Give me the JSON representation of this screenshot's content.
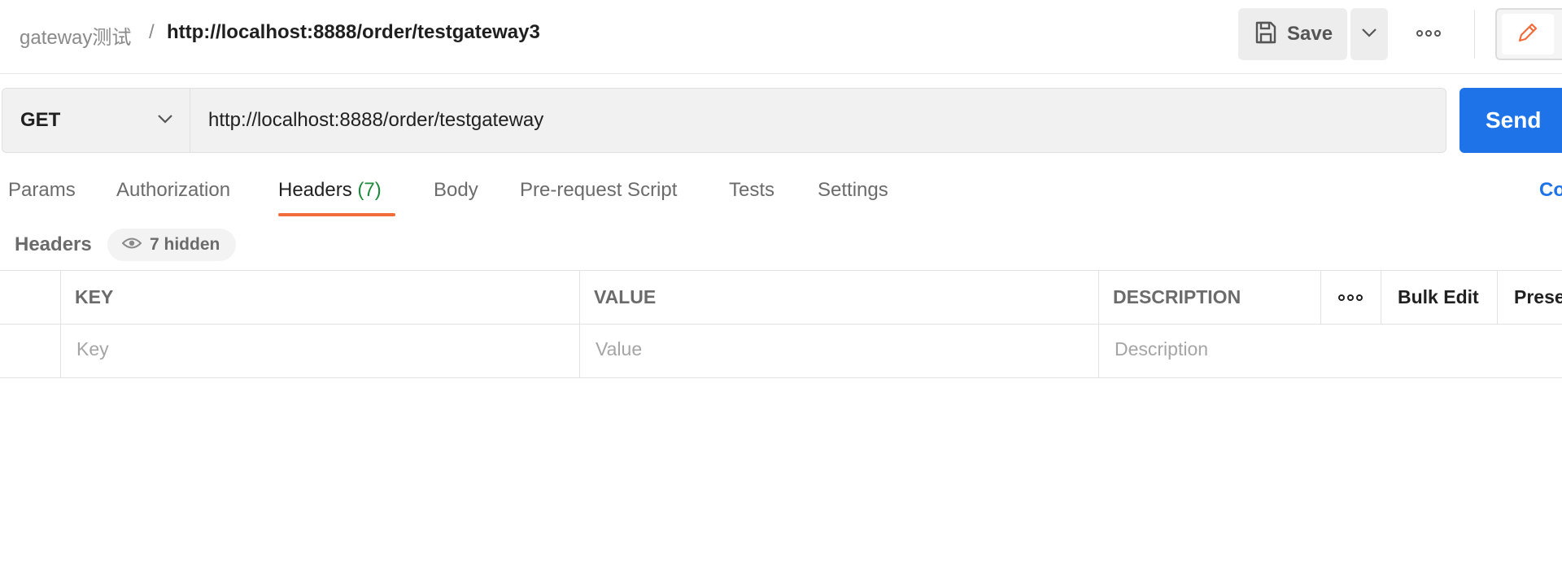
{
  "breadcrumb": {
    "parent": "gateway测试",
    "separator": "/",
    "current": "http://localhost:8888/order/testgateway3"
  },
  "toolbar": {
    "save_label": "Save",
    "save_icon": "floppy-disk-icon",
    "dropdown_icon": "chevron-down-icon",
    "more_icon": "more-horizontal-icon",
    "edit_icon": "pencil-icon"
  },
  "request": {
    "method": "GET",
    "url": "http://localhost:8888/order/testgateway",
    "send_label": "Send"
  },
  "tabs": [
    {
      "label": "Params"
    },
    {
      "label": "Authorization"
    },
    {
      "label": "Headers",
      "count": "(7)",
      "active": true
    },
    {
      "label": "Body"
    },
    {
      "label": "Pre-request Script"
    },
    {
      "label": "Tests"
    },
    {
      "label": "Settings"
    }
  ],
  "cookies_label": "Co",
  "headers_section": {
    "title": "Headers",
    "hidden_label": "7 hidden",
    "hidden_icon": "eye-icon"
  },
  "table": {
    "columns": {
      "key": "KEY",
      "value": "VALUE",
      "description": "DESCRIPTION",
      "bulk_edit": "Bulk Edit",
      "presets": "Prese"
    },
    "placeholders": {
      "key": "Key",
      "value": "Value",
      "description": "Description"
    }
  },
  "colors": {
    "accent": "#1e73e8",
    "tab_underline": "#f26b3a",
    "count": "#1c8a3a"
  }
}
